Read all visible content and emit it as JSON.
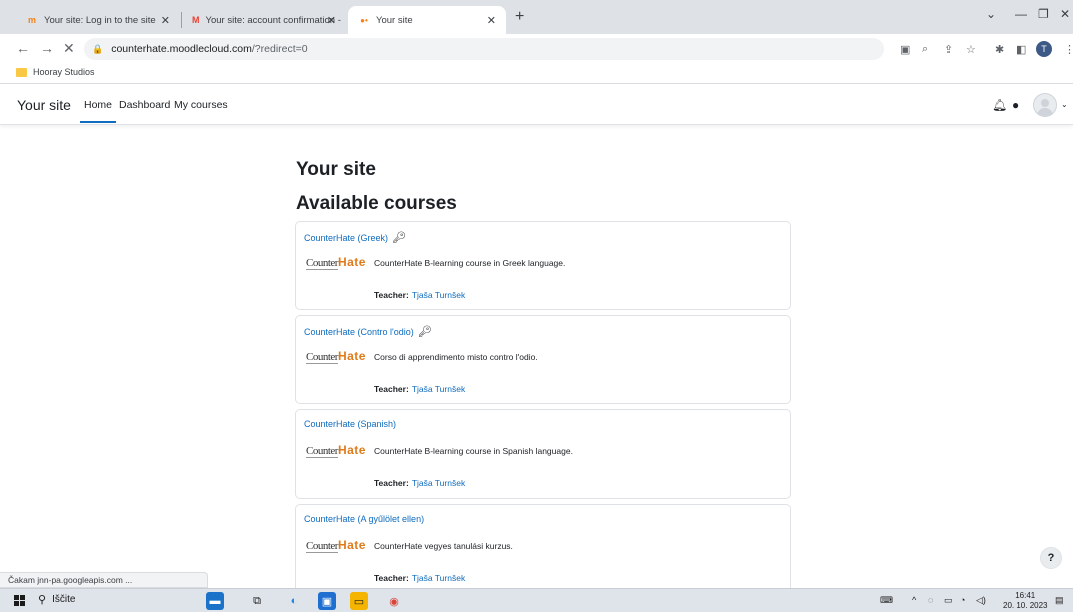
{
  "browser": {
    "tabs": [
      {
        "title": "Your site: Log in to the site",
        "favicon": "moodle-icon"
      },
      {
        "title": "Your site: account confirmation -",
        "favicon": "gmail-icon"
      },
      {
        "title": "Your site",
        "favicon": "loading-icon"
      }
    ],
    "address": {
      "host": "counterhate.moodlecloud.com",
      "path": "/?redirect=0"
    },
    "bookmark": "Hooray Studios",
    "profile_initial": "T",
    "status": "Čakam jnn-pa.googleapis.com ..."
  },
  "navbar": {
    "brand": "Your site",
    "links": [
      "Home",
      "Dashboard",
      "My courses"
    ]
  },
  "main": {
    "page_title": "Your site",
    "section_title": "Available courses",
    "teacher_label": "Teacher:",
    "logo": {
      "left": "Counter",
      "right": "Hate"
    },
    "courses": [
      {
        "name": "CounterHate (Greek)",
        "key": true,
        "summary": "CounterHate B-learning course in Greek language.",
        "teacher": "Tjaša Turnšek"
      },
      {
        "name": "CounterHate (Contro l'odio)",
        "key": true,
        "summary": "Corso di apprendimento misto contro l'odio.",
        "teacher": "Tjaša Turnšek"
      },
      {
        "name": "CounterHate (Spanish)",
        "key": false,
        "summary": "CounterHate B-learning course in Spanish language.",
        "teacher": "Tjaša Turnšek"
      },
      {
        "name": "CounterHate (A gyűlölet ellen)",
        "key": false,
        "summary": "CounterHate vegyes tanulási kurzus.",
        "teacher": "Tjaša Turnšek"
      }
    ]
  },
  "help_button": "?",
  "taskbar": {
    "search_placeholder": "Iščite",
    "time": "16:41",
    "date": "20. 10. 2023"
  },
  "colors": {
    "link": "#0f6cbf",
    "logo_accent": "#e07b1b"
  }
}
